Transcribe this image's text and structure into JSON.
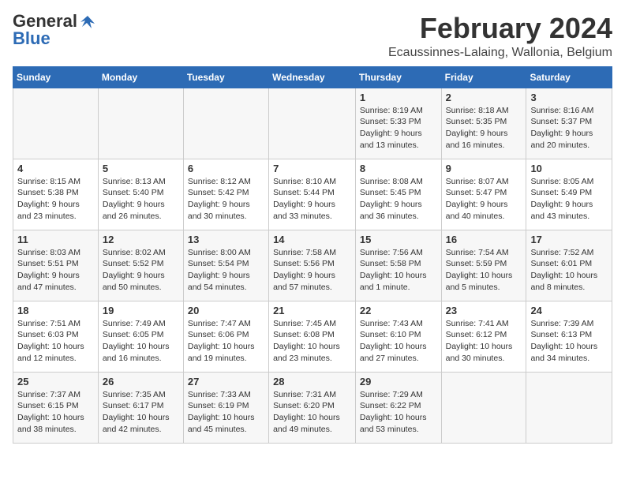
{
  "logo": {
    "general": "General",
    "blue": "Blue"
  },
  "title": "February 2024",
  "location": "Ecaussinnes-Lalaing, Wallonia, Belgium",
  "days_of_week": [
    "Sunday",
    "Monday",
    "Tuesday",
    "Wednesday",
    "Thursday",
    "Friday",
    "Saturday"
  ],
  "weeks": [
    [
      {
        "day": "",
        "info": ""
      },
      {
        "day": "",
        "info": ""
      },
      {
        "day": "",
        "info": ""
      },
      {
        "day": "",
        "info": ""
      },
      {
        "day": "1",
        "info": "Sunrise: 8:19 AM\nSunset: 5:33 PM\nDaylight: 9 hours\nand 13 minutes."
      },
      {
        "day": "2",
        "info": "Sunrise: 8:18 AM\nSunset: 5:35 PM\nDaylight: 9 hours\nand 16 minutes."
      },
      {
        "day": "3",
        "info": "Sunrise: 8:16 AM\nSunset: 5:37 PM\nDaylight: 9 hours\nand 20 minutes."
      }
    ],
    [
      {
        "day": "4",
        "info": "Sunrise: 8:15 AM\nSunset: 5:38 PM\nDaylight: 9 hours\nand 23 minutes."
      },
      {
        "day": "5",
        "info": "Sunrise: 8:13 AM\nSunset: 5:40 PM\nDaylight: 9 hours\nand 26 minutes."
      },
      {
        "day": "6",
        "info": "Sunrise: 8:12 AM\nSunset: 5:42 PM\nDaylight: 9 hours\nand 30 minutes."
      },
      {
        "day": "7",
        "info": "Sunrise: 8:10 AM\nSunset: 5:44 PM\nDaylight: 9 hours\nand 33 minutes."
      },
      {
        "day": "8",
        "info": "Sunrise: 8:08 AM\nSunset: 5:45 PM\nDaylight: 9 hours\nand 36 minutes."
      },
      {
        "day": "9",
        "info": "Sunrise: 8:07 AM\nSunset: 5:47 PM\nDaylight: 9 hours\nand 40 minutes."
      },
      {
        "day": "10",
        "info": "Sunrise: 8:05 AM\nSunset: 5:49 PM\nDaylight: 9 hours\nand 43 minutes."
      }
    ],
    [
      {
        "day": "11",
        "info": "Sunrise: 8:03 AM\nSunset: 5:51 PM\nDaylight: 9 hours\nand 47 minutes."
      },
      {
        "day": "12",
        "info": "Sunrise: 8:02 AM\nSunset: 5:52 PM\nDaylight: 9 hours\nand 50 minutes."
      },
      {
        "day": "13",
        "info": "Sunrise: 8:00 AM\nSunset: 5:54 PM\nDaylight: 9 hours\nand 54 minutes."
      },
      {
        "day": "14",
        "info": "Sunrise: 7:58 AM\nSunset: 5:56 PM\nDaylight: 9 hours\nand 57 minutes."
      },
      {
        "day": "15",
        "info": "Sunrise: 7:56 AM\nSunset: 5:58 PM\nDaylight: 10 hours\nand 1 minute."
      },
      {
        "day": "16",
        "info": "Sunrise: 7:54 AM\nSunset: 5:59 PM\nDaylight: 10 hours\nand 5 minutes."
      },
      {
        "day": "17",
        "info": "Sunrise: 7:52 AM\nSunset: 6:01 PM\nDaylight: 10 hours\nand 8 minutes."
      }
    ],
    [
      {
        "day": "18",
        "info": "Sunrise: 7:51 AM\nSunset: 6:03 PM\nDaylight: 10 hours\nand 12 minutes."
      },
      {
        "day": "19",
        "info": "Sunrise: 7:49 AM\nSunset: 6:05 PM\nDaylight: 10 hours\nand 16 minutes."
      },
      {
        "day": "20",
        "info": "Sunrise: 7:47 AM\nSunset: 6:06 PM\nDaylight: 10 hours\nand 19 minutes."
      },
      {
        "day": "21",
        "info": "Sunrise: 7:45 AM\nSunset: 6:08 PM\nDaylight: 10 hours\nand 23 minutes."
      },
      {
        "day": "22",
        "info": "Sunrise: 7:43 AM\nSunset: 6:10 PM\nDaylight: 10 hours\nand 27 minutes."
      },
      {
        "day": "23",
        "info": "Sunrise: 7:41 AM\nSunset: 6:12 PM\nDaylight: 10 hours\nand 30 minutes."
      },
      {
        "day": "24",
        "info": "Sunrise: 7:39 AM\nSunset: 6:13 PM\nDaylight: 10 hours\nand 34 minutes."
      }
    ],
    [
      {
        "day": "25",
        "info": "Sunrise: 7:37 AM\nSunset: 6:15 PM\nDaylight: 10 hours\nand 38 minutes."
      },
      {
        "day": "26",
        "info": "Sunrise: 7:35 AM\nSunset: 6:17 PM\nDaylight: 10 hours\nand 42 minutes."
      },
      {
        "day": "27",
        "info": "Sunrise: 7:33 AM\nSunset: 6:19 PM\nDaylight: 10 hours\nand 45 minutes."
      },
      {
        "day": "28",
        "info": "Sunrise: 7:31 AM\nSunset: 6:20 PM\nDaylight: 10 hours\nand 49 minutes."
      },
      {
        "day": "29",
        "info": "Sunrise: 7:29 AM\nSunset: 6:22 PM\nDaylight: 10 hours\nand 53 minutes."
      },
      {
        "day": "",
        "info": ""
      },
      {
        "day": "",
        "info": ""
      }
    ]
  ]
}
